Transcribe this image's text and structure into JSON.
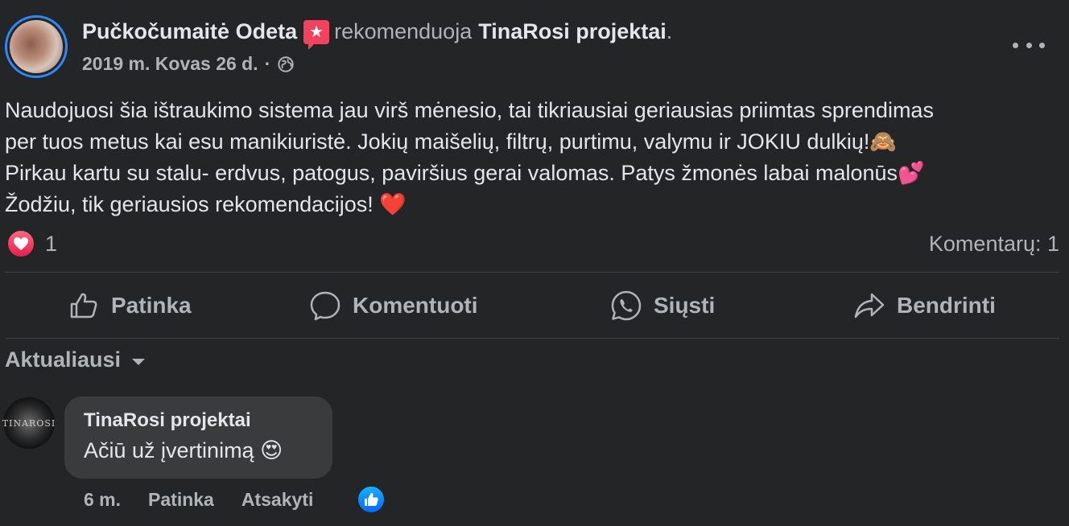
{
  "post": {
    "author": "Pučkočumaitė Odeta",
    "recommends_word": "rekomenduoja",
    "page_name": "TinaRosi projektai",
    "date": "2019 m. Kovas 26 d.",
    "separator": "·",
    "text_lines": [
      "Naudojuosi šia ištraukimo sistema jau virš mėnesio, tai tikriausiai geriausias priimtas sprendimas",
      "per tuos metus kai esu manikiuristė. Jokių maišelių, filtrų, purtimu, valymu ir JOKIU dulkių!🙈",
      "Pirkau kartu su stalu- erdvus, patogus, paviršius gerai valomas. Patys žmonės labai malonūs💕",
      "Žodžiu, tik geriausios rekomendacijos! ❤️"
    ]
  },
  "reactions": {
    "count": "1",
    "comments_label": "Komentarų: 1"
  },
  "actions": {
    "like": "Patinka",
    "comment": "Komentuoti",
    "send": "Siųsti",
    "share": "Bendrinti"
  },
  "sort": {
    "label": "Aktualiausi"
  },
  "comment": {
    "author": "TinaRosi projektai",
    "text": "Ačiū už įvertinimą 😍",
    "time": "6 m.",
    "like": "Patinka",
    "reply": "Atsakyti",
    "avatar_text": "TINAROSI"
  },
  "colors": {
    "background": "#242526",
    "bubble": "#3a3b3c",
    "primary_text": "#e4e6eb",
    "secondary_text": "#b0b3b8",
    "accent_blue": "#2d88ff",
    "love_red": "#f3425f"
  }
}
